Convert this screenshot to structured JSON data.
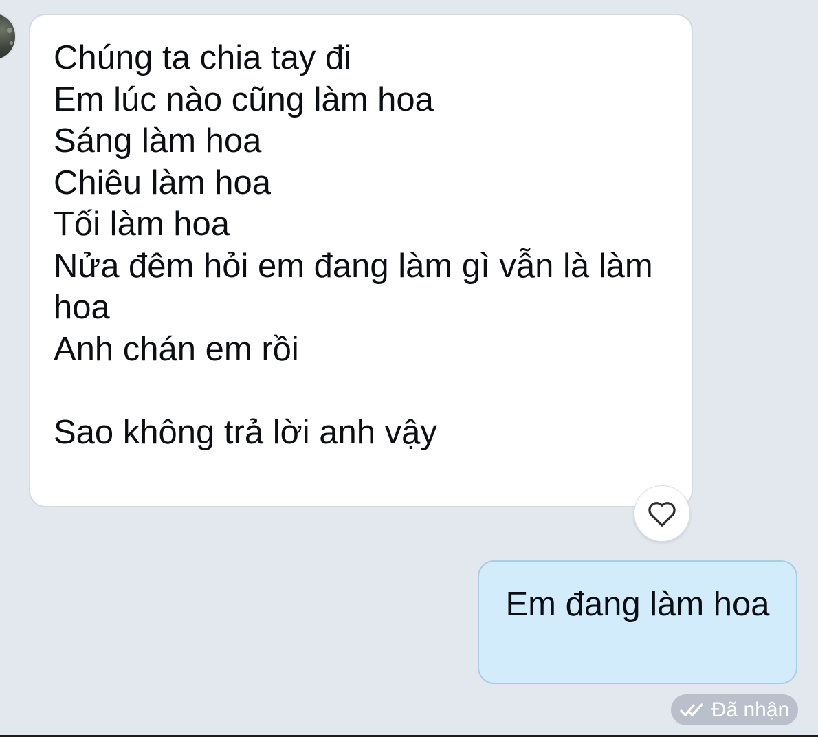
{
  "incoming_message": {
    "text": "Chúng ta chia tay đi\nEm lúc nào cũng làm hoa\nSáng làm hoa\nChiêu làm hoa\nTối làm hoa\nNửa đêm hỏi em đang làm gì vẫn là làm hoa\nAnh chán em rồi\n\nSao không trả lời anh vậy",
    "reaction_icon": "heart-outline-icon"
  },
  "outgoing_message": {
    "text": "Em đang làm hoa",
    "status_icon": "double-check-icon",
    "status_label": "Đã nhận"
  },
  "colors": {
    "background": "#e3e7ee",
    "incoming_bubble": "#ffffff",
    "outgoing_bubble": "#d3ecfb",
    "outgoing_border": "#a9cde5",
    "status_badge": "#b9c0cb"
  }
}
